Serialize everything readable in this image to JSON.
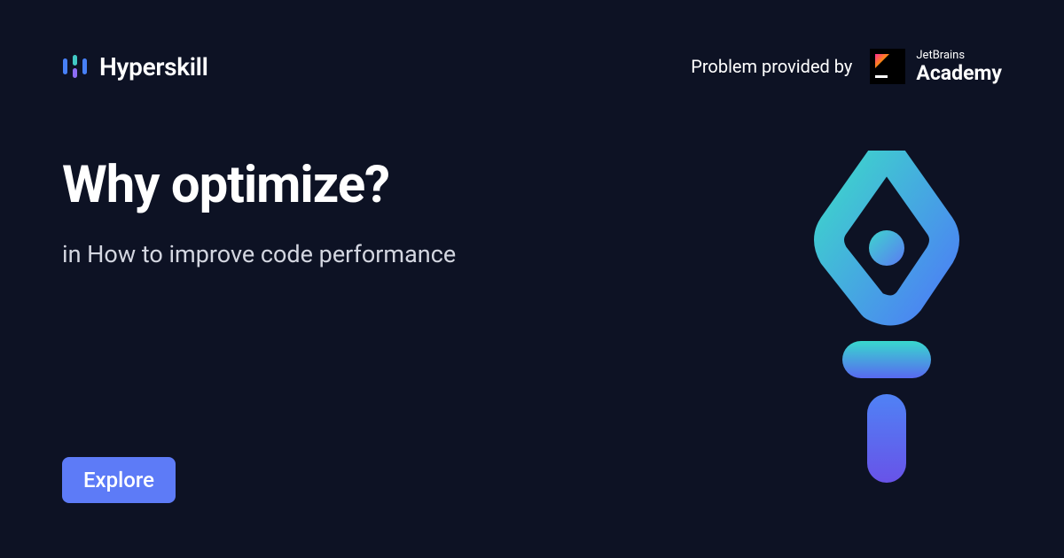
{
  "header": {
    "brand": "Hyperskill",
    "provided_by": "Problem provided by",
    "partner_small": "JetBrains",
    "partner_big": "Academy"
  },
  "main": {
    "title": "Why optimize?",
    "subtitle": "in How to improve code performance"
  },
  "cta": {
    "explore": "Explore"
  }
}
